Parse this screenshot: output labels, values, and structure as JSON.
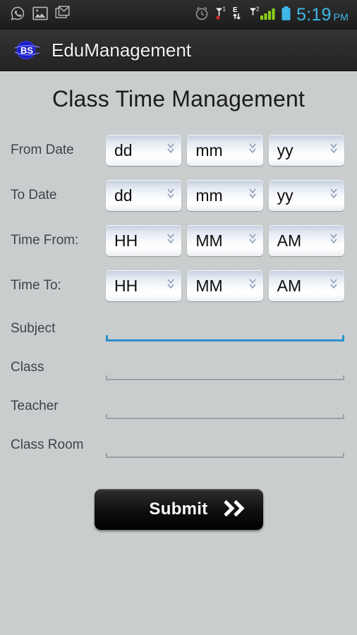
{
  "statusbar": {
    "left_icons": [
      {
        "name": "whatsapp-icon",
        "label": "WhatsApp"
      },
      {
        "name": "gallery-icon",
        "label": "Gallery"
      },
      {
        "name": "gmail-icon",
        "label": "Gmail"
      }
    ],
    "right_icons": [
      {
        "name": "alarm-clock-icon",
        "label": "Alarm"
      },
      {
        "name": "sim1-no-service-icon",
        "label": "SIM 1 no service"
      },
      {
        "name": "edge-data-icon",
        "label": "E"
      },
      {
        "name": "sim2-signal-icon",
        "label": "SIM 2 signal"
      },
      {
        "name": "battery-icon",
        "label": "Battery"
      }
    ],
    "time": "5:19",
    "ampm": "PM",
    "clock_color": "#3fb8e8",
    "signal_color": "#8cd11a",
    "battery_color": "#3fb8e8"
  },
  "actionbar": {
    "logo_text": "BS",
    "app_title": "EduManagement",
    "background": "#2b2b2b"
  },
  "page": {
    "title": "Class Time Management",
    "background": "#c9cdce"
  },
  "form": {
    "spinner_rows": [
      {
        "label": "From Date",
        "spinners": [
          {
            "name": "from-date-day-spinner",
            "value": "dd"
          },
          {
            "name": "from-date-month-spinner",
            "value": "mm"
          },
          {
            "name": "from-date-year-spinner",
            "value": "yy"
          }
        ]
      },
      {
        "label": "To Date",
        "spinners": [
          {
            "name": "to-date-day-spinner",
            "value": "dd"
          },
          {
            "name": "to-date-month-spinner",
            "value": "mm"
          },
          {
            "name": "to-date-year-spinner",
            "value": "yy"
          }
        ]
      },
      {
        "label": "Time From:",
        "spinners": [
          {
            "name": "time-from-hour-spinner",
            "value": "HH"
          },
          {
            "name": "time-from-minute-spinner",
            "value": "MM"
          },
          {
            "name": "time-from-meridiem-spinner",
            "value": "AM"
          }
        ]
      },
      {
        "label": "Time To:",
        "spinners": [
          {
            "name": "time-to-hour-spinner",
            "value": "HH"
          },
          {
            "name": "time-to-minute-spinner",
            "value": "MM"
          },
          {
            "name": "time-to-meridiem-spinner",
            "value": "AM"
          }
        ]
      }
    ],
    "text_rows": [
      {
        "label": "Subject",
        "name": "subject-input",
        "value": "",
        "focused": true
      },
      {
        "label": "Class",
        "name": "class-input",
        "value": "",
        "focused": false
      },
      {
        "label": "Teacher",
        "name": "teacher-input",
        "value": "",
        "focused": false
      },
      {
        "label": "Class Room",
        "name": "class-room-input",
        "value": "",
        "focused": false
      }
    ],
    "focus_color": "#2b91c9",
    "idle_color": "#9ba0a2"
  },
  "submit": {
    "label": "Submit",
    "arrow_icon": "double-chevron-right-icon"
  }
}
